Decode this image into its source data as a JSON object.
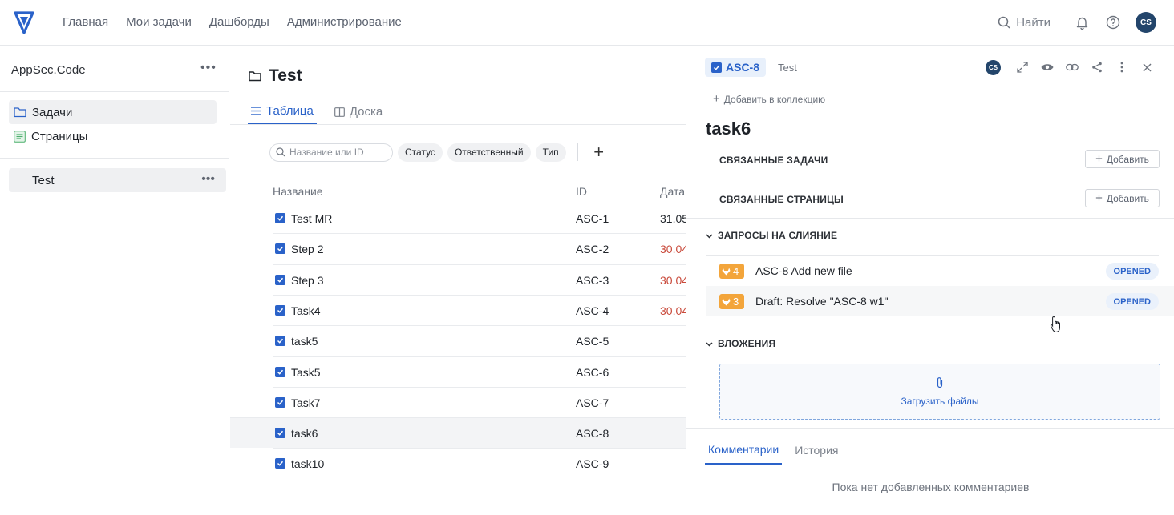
{
  "topbar": {
    "nav": [
      "Главная",
      "Мои задачи",
      "Дашборды",
      "Администрирование"
    ],
    "search_label": "Найти",
    "avatar_initials": "CS"
  },
  "sidebar": {
    "workspace": "AppSec.Code",
    "items": [
      {
        "label": "Задачи",
        "icon": "folder-icon",
        "active": true
      },
      {
        "label": "Страницы",
        "icon": "pages-icon",
        "active": false
      }
    ],
    "project": "Test"
  },
  "main": {
    "title": "Test",
    "tabs": [
      {
        "label": "Таблица",
        "active": true
      },
      {
        "label": "Доска",
        "active": false
      }
    ],
    "filters": {
      "search_placeholder": "Название или ID",
      "chips": [
        "Статус",
        "Ответственный",
        "Тип"
      ]
    },
    "table": {
      "columns": [
        "Название",
        "ID",
        "Дата"
      ],
      "rows": [
        {
          "name": "Test MR",
          "id": "ASC-1",
          "date": "31.05",
          "overdue": false
        },
        {
          "name": "Step 2",
          "id": "ASC-2",
          "date": "30.04",
          "overdue": true
        },
        {
          "name": "Step 3",
          "id": "ASC-3",
          "date": "30.04",
          "overdue": true
        },
        {
          "name": "Task4",
          "id": "ASC-4",
          "date": "30.04",
          "overdue": true
        },
        {
          "name": "task5",
          "id": "ASC-5",
          "date": "",
          "overdue": false
        },
        {
          "name": "Task5",
          "id": "ASC-6",
          "date": "",
          "overdue": false
        },
        {
          "name": "Task7",
          "id": "ASC-7",
          "date": "",
          "overdue": false
        },
        {
          "name": "task6",
          "id": "ASC-8",
          "date": "",
          "overdue": false
        },
        {
          "name": "task10",
          "id": "ASC-9",
          "date": "",
          "overdue": false
        }
      ]
    }
  },
  "panel": {
    "key": "ASC-8",
    "project": "Test",
    "avatar_initials": "CS",
    "add_to_collection": "Добавить в коллекцию",
    "title": "task6",
    "related_tasks_label": "СВЯЗАННЫЕ ЗАДАЧИ",
    "related_pages_label": "СВЯЗАННЫЕ СТРАНИЦЫ",
    "add_label": "Добавить",
    "merge_requests_label": "ЗАПРОСЫ НА СЛИЯНИЕ",
    "merge_requests": [
      {
        "num": "4",
        "title": "ASC-8 Add new file",
        "status": "OPENED"
      },
      {
        "num": "3",
        "title": "Draft: Resolve \"ASC-8 w1\"",
        "status": "OPENED"
      }
    ],
    "attachments_label": "ВЛОЖЕНИЯ",
    "upload_label": "Загрузить файлы",
    "comment_tabs": [
      {
        "label": "Комментарии",
        "active": true
      },
      {
        "label": "История",
        "active": false
      }
    ],
    "no_comments": "Пока нет добавленных комментариев"
  },
  "colors": {
    "accent": "#2a62c9",
    "overdue": "#c94a3b",
    "gitlab": "#f3a53b",
    "avatar": "#23456b"
  }
}
